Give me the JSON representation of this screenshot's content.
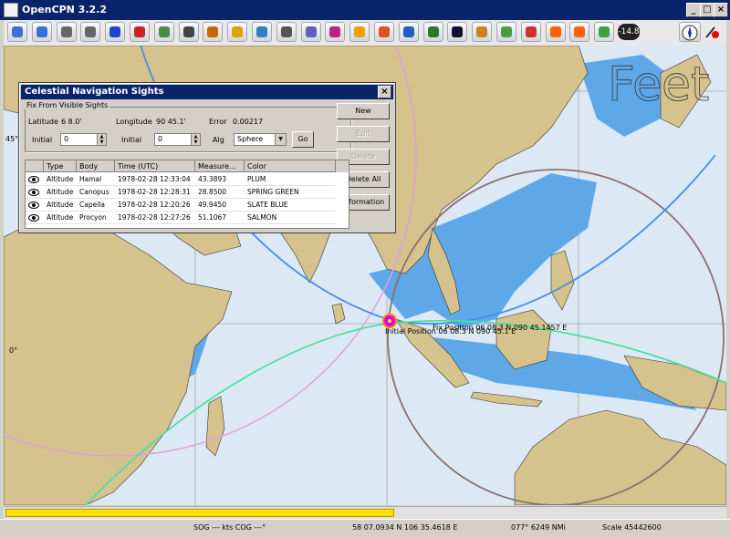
{
  "window": {
    "title": "OpenCPN 3.2.2",
    "minimize": "_",
    "maximize": "□",
    "close": "×"
  },
  "toolbar": {
    "buttons": [
      "zoom-in-icon",
      "zoom-out-icon",
      "funnel-icon",
      "anchor-icon",
      "route-icon",
      "ship-icon",
      "tide-icon",
      "text-icon",
      "waypoint-icon",
      "layers-icon",
      "chart-icon",
      "print-icon",
      "graph-icon",
      "track-icon",
      "sun-icon",
      "lifebuoy-icon",
      "help-icon",
      "star-icon",
      "night-icon",
      "palette-icon",
      "settings-icon",
      "lifering-icon",
      "record-icon",
      "record-alt-icon",
      "download-icon"
    ],
    "readout": "-14.8"
  },
  "chart": {
    "feet_label": "Feet",
    "lat_label_1": "45°",
    "lat_label_2": "0°",
    "position_label": "Initial Position 06 08.3 N 090 45.1 E",
    "overlay_label": "Fix Position 06 08.3 N 090 45.1457 E"
  },
  "dialog": {
    "title": "Celestial Navigation Sights",
    "close_label": "×",
    "fix_group": "Fix From Visible Sights",
    "latitude_label": "Latitude",
    "latitude_value": "6 8.0'",
    "longitude_label": "Longitude",
    "longitude_value": "90 45.1'",
    "error_label": "Error",
    "error_value": "0.00217",
    "initial_label_1": "Initial",
    "initial_value_1": "0",
    "initial_label_2": "Initial",
    "initial_value_2": "0",
    "alg_label": "Alg",
    "alg_value": "Sphere",
    "go_label": "Go",
    "buttons": {
      "new": "New",
      "edit": "Edit",
      "delete": "Delete",
      "delete_all": "Delete All",
      "information": "Information"
    },
    "columns": [
      "",
      "Type",
      "Body",
      "Time (UTC)",
      "Measure...",
      "Color"
    ],
    "rows": [
      {
        "type": "Altitude",
        "body": "Hamal",
        "time": "1978-02-28 12:33:04",
        "measurement": "43.3893",
        "color": "PLUM"
      },
      {
        "type": "Altitude",
        "body": "Canopus",
        "time": "1978-02-28 12:28:31",
        "measurement": "28.8500",
        "color": "SPRING GREEN"
      },
      {
        "type": "Altitude",
        "body": "Capella",
        "time": "1978-02-28 12:20:26",
        "measurement": "49.9450",
        "color": "SLATE BLUE"
      },
      {
        "type": "Altitude",
        "body": "Procyon",
        "time": "1978-02-28 12:27:26",
        "measurement": "51.1067",
        "color": "SALMON"
      }
    ]
  },
  "progress": {
    "fraction": 0.54
  },
  "status": {
    "sog": "SOG --- kts  COG ---°",
    "position": "58 07.0934 N   106 35.4618 E",
    "bearing": "077°  6249 NMi",
    "scale": "Scale 45442600"
  },
  "colors": {
    "land": "#d6c28c",
    "sea": "#dce9f4",
    "shallow": "#5ea8e8",
    "title_bar": "#0a246a"
  }
}
